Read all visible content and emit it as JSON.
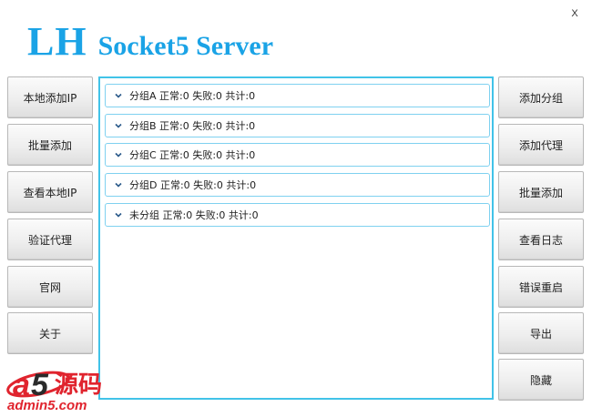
{
  "window": {
    "close_label": "X",
    "title_short": "LH",
    "title_app": "Socket5 Server"
  },
  "left_buttons": [
    "本地添加IP",
    "批量添加",
    "查看本地IP",
    "验证代理",
    "官网",
    "关于"
  ],
  "right_buttons": [
    "添加分组",
    "添加代理",
    "批量添加",
    "查看日志",
    "错误重启",
    "导出",
    "隐藏"
  ],
  "groups": [
    {
      "label": "分组A 正常:0 失败:0 共计:0"
    },
    {
      "label": "分组B 正常:0 失败:0 共计:0"
    },
    {
      "label": "分组C 正常:0 失败:0 共计:0"
    },
    {
      "label": "分组D 正常:0 失败:0 共计:0"
    },
    {
      "label": "未分组 正常:0 失败:0 共计:0"
    }
  ],
  "watermark": {
    "logo_text": "a5源码",
    "site": "admin5.com"
  },
  "colors": {
    "title": "#1aa3e6",
    "panel_border": "#41c3e8",
    "group_border": "#7fd1f0",
    "watermark_red": "#e0242e"
  }
}
